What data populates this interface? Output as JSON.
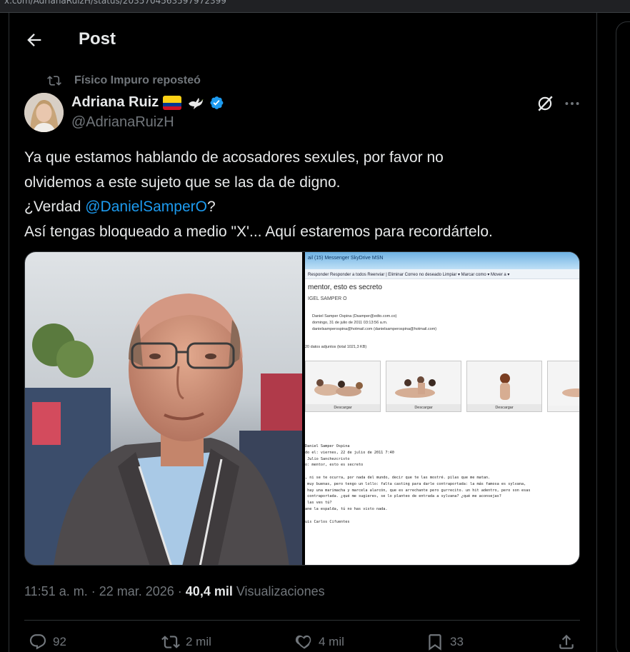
{
  "browser": {
    "url": "x.com/AdrianaRuizH/status/2035704563597972399"
  },
  "header": {
    "title": "Post"
  },
  "repost": {
    "label": "Físico Impuro reposteó"
  },
  "author": {
    "name": "Adriana Ruiz",
    "handle": "@AdrianaRuizH",
    "emoji_flag": "Colombia flag",
    "emoji_dove": "dove"
  },
  "tweet": {
    "line1": "Ya que estamos hablando de acosadores sexules, por favor no",
    "line2": "olvidemos a este sujeto que se las da de digno.",
    "line3_pre": "¿Verdad ",
    "mention": "@DanielSamperO",
    "line3_post": "?",
    "line4": "Así tengas bloqueado a medio \"X'... Aquí estaremos para recordártelo."
  },
  "email_screenshot": {
    "tabs": "ail (15)      Messenger      SkyDrive      MSN",
    "toolbar": "Responder   Responder a todos   Reenviar  |  Eliminar   Correo no deseado   Limpiar ▾   Marcar como ▾   Mover a ▾",
    "subject": "mentor, esto es secreto",
    "from": "IGEL SAMPER O",
    "meta_line1": "Daniel Samper Ospina (Dsamper@edto.com.co)",
    "meta_line2": "domingo, 31 de julio de 2011 03:13:56 a.m.",
    "meta_line3": "danielsamperospina@hotmail.com (danielsamperospina@hotmail.com)",
    "attachments": "20 datos adjuntos (total 1021,3 KB)",
    "download_label": "Descargar",
    "body": "Daniel Samper Ospina\ndo el: viernes, 22 de julio de 2011 7:40\n Julio Sanchezcristo\no: mentor, esto es secreto\n\n, ni se te ocurra, por nada del mundo, decir que te las mostré. pilas que me matan.\n muy buenas, pero tengo un lollo: falta casting para darle contraportada: la más famosa es sylvana,\n hay una marimacha y marcela alarcón, que es arrechante pero gurrecito. un hit adentro, pero son esas\n contraportada. ¿qué me sugieres, se lo planteo de entrada a sylvana? ¿qué me aconsejas?\n las ves tú?\nane la espalda, tú no has visto nada.\n\nuis Carlos Cifuentes"
  },
  "meta": {
    "time": "11:51 a. m. · 22 mar. 2026 · ",
    "views_count": "40,4 mil",
    "views_label": " Visualizaciones"
  },
  "actions": {
    "replies": "92",
    "reposts": "2 mil",
    "likes": "4 mil",
    "bookmarks": "33"
  },
  "colors": {
    "accent": "#1d9bf0",
    "muted": "#71767b",
    "text": "#e7e9ea",
    "border": "#2f3336"
  }
}
